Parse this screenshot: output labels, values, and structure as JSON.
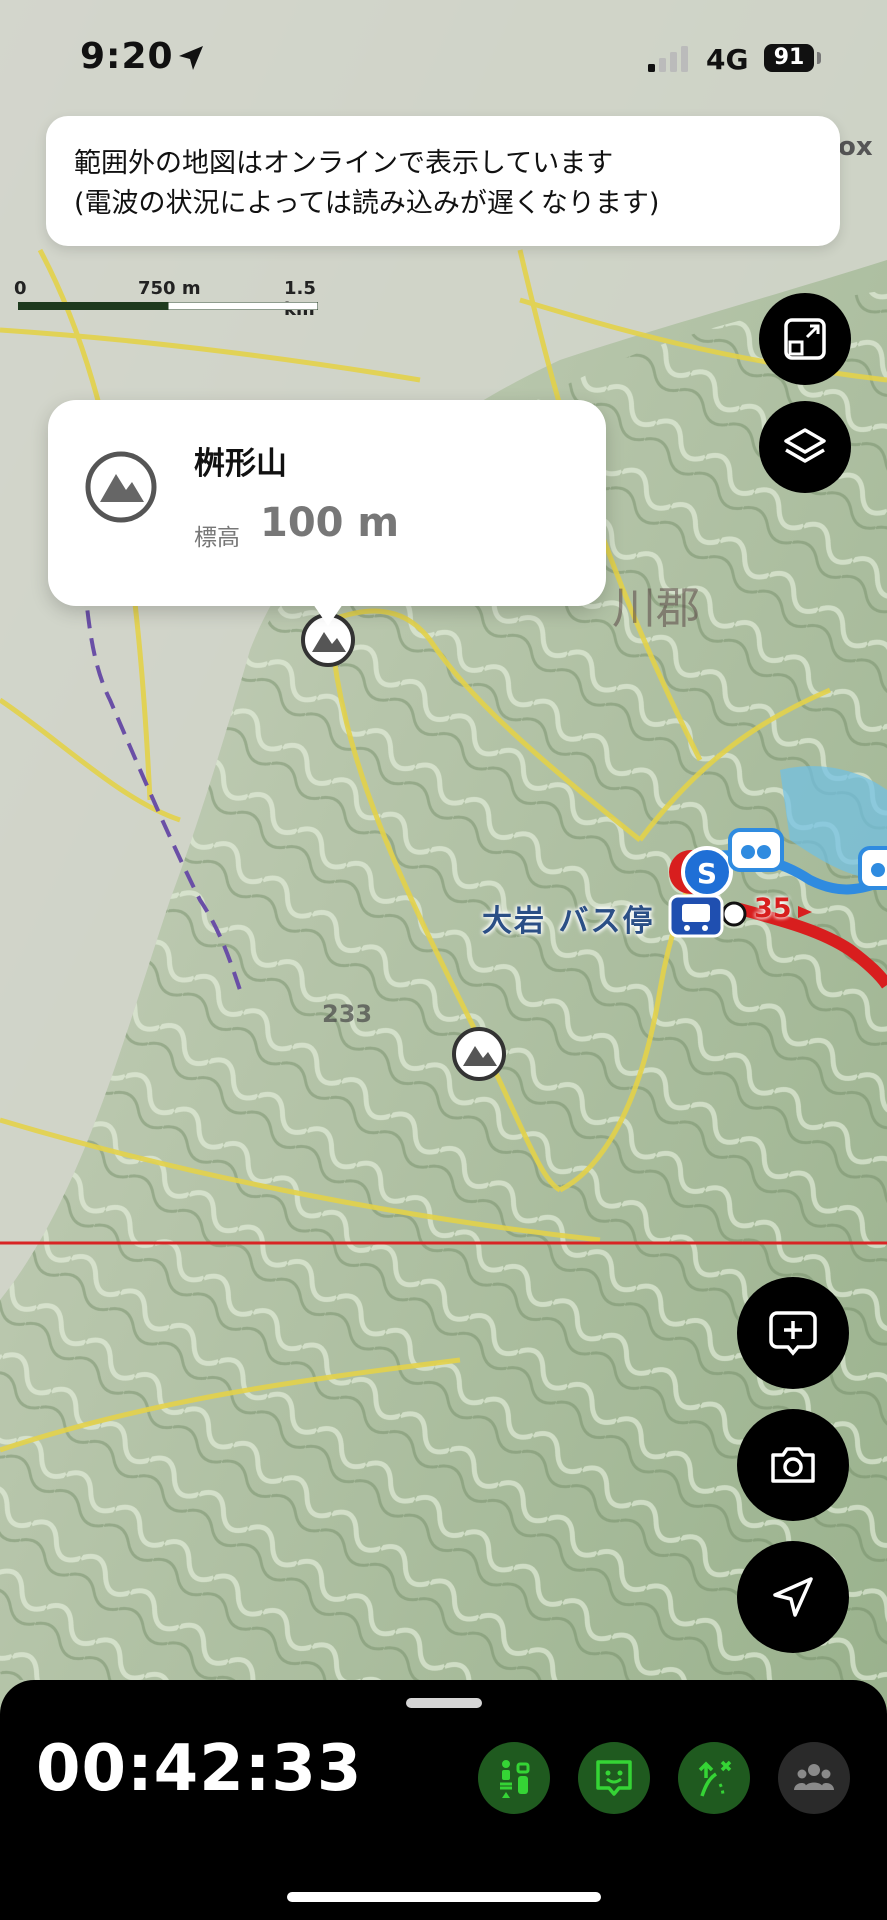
{
  "status_bar": {
    "time": "9:20",
    "network": "4G",
    "battery": "91"
  },
  "banner": {
    "line1": "範囲外の地図はオンラインで表示しています",
    "line2": "(電波の状況によっては読み込みが遅くなります)"
  },
  "scale": {
    "t0": "0",
    "t1": "750 m",
    "t2": "1.5 km"
  },
  "popup": {
    "name": "桝形山",
    "elevation_label": "標高",
    "elevation_value": "100 m"
  },
  "map_labels": {
    "bus_stop": "大岩 バス停",
    "route_number": "35",
    "region": "川郡",
    "elevation_marker": "233",
    "corner_text": "ox"
  },
  "buttons": {
    "fit": "fit-screen-icon",
    "layers": "layers-icon",
    "add": "add-comment-icon",
    "camera": "camera-icon",
    "location": "location-arrow-icon"
  },
  "bottom": {
    "timer": "00:42:33"
  },
  "colors": {
    "green": "#2db52d",
    "route_red": "#d81e1e",
    "route_blue": "#2f8be0"
  }
}
